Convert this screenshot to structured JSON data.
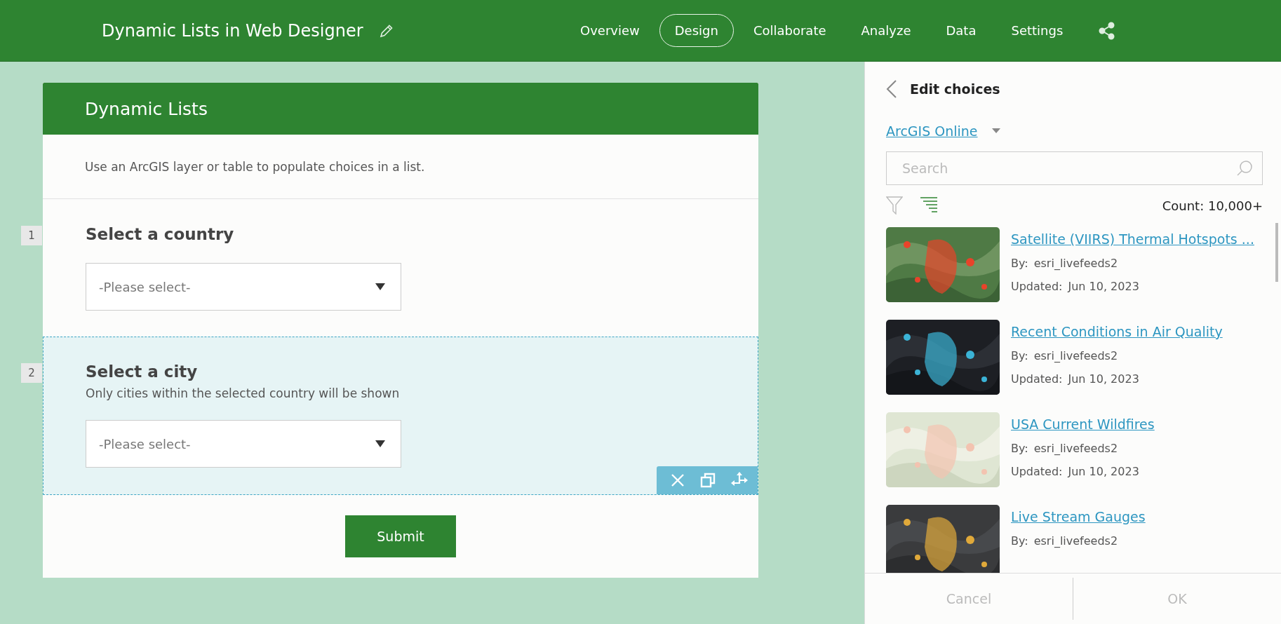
{
  "header": {
    "title": "Dynamic Lists in Web Designer",
    "nav": [
      {
        "label": "Overview",
        "selected": false
      },
      {
        "label": "Design",
        "selected": true
      },
      {
        "label": "Collaborate",
        "selected": false
      },
      {
        "label": "Analyze",
        "selected": false
      },
      {
        "label": "Data",
        "selected": false
      },
      {
        "label": "Settings",
        "selected": false
      }
    ]
  },
  "form": {
    "title": "Dynamic Lists",
    "description": "Use an ArcGIS layer or table to populate choices in a list.",
    "questions": [
      {
        "number": "1",
        "label": "Select a country",
        "placeholder": "-Please select-",
        "selected": false
      },
      {
        "number": "2",
        "label": "Select a city",
        "hint": "Only cities within the selected country will be shown",
        "placeholder": "-Please select-",
        "selected": true
      }
    ],
    "submit": "Submit"
  },
  "panel": {
    "title": "Edit choices",
    "source": "ArcGIS Online",
    "search": {
      "placeholder": "Search"
    },
    "count": "Count: 10,000+",
    "items": [
      {
        "title": "Satellite (VIIRS) Thermal Hotspots ...",
        "by_label": "By:",
        "by": "esri_livefeeds2",
        "updated_label": "Updated:",
        "updated": "Jun 10, 2023"
      },
      {
        "title": "Recent Conditions in Air Quality",
        "by_label": "By:",
        "by": "esri_livefeeds2",
        "updated_label": "Updated:",
        "updated": "Jun 10, 2023"
      },
      {
        "title": "USA Current Wildfires",
        "by_label": "By:",
        "by": "esri_livefeeds2",
        "updated_label": "Updated:",
        "updated": "Jun 10, 2023"
      },
      {
        "title": "Live Stream Gauges",
        "by_label": "By:",
        "by": "esri_livefeeds2"
      }
    ],
    "buttons": [
      {
        "label": "Cancel",
        "disabled": true
      },
      {
        "label": "OK",
        "disabled": true
      }
    ]
  }
}
